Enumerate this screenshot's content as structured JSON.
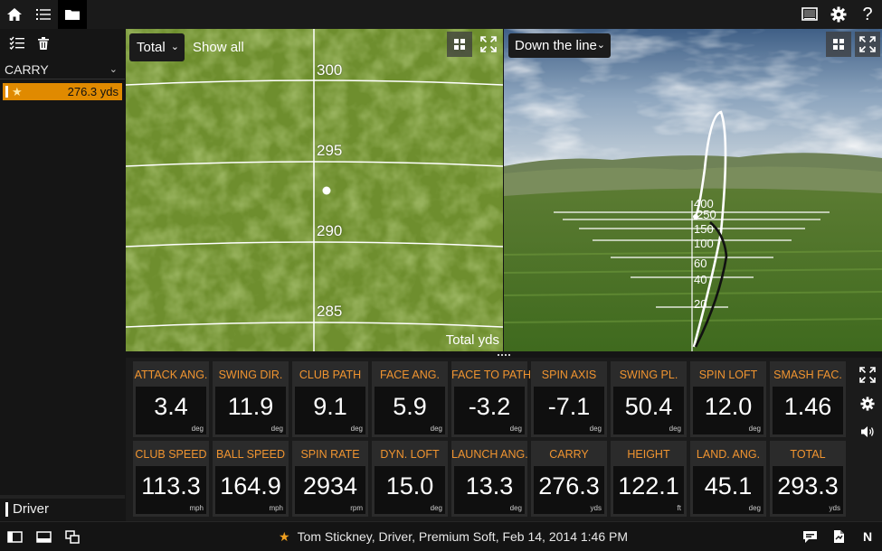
{
  "topbar": {
    "left_icons": [
      "home-icon",
      "list-icon",
      "folder-icon"
    ],
    "right_icons": [
      "screen-icon",
      "gear-icon",
      "help-icon"
    ],
    "help_glyph": "?"
  },
  "sidebar": {
    "tools": [
      "checklist-icon",
      "trash-icon"
    ],
    "parameter_selected": "CARRY",
    "shots": [
      {
        "star": "★",
        "value": "276.3 yds",
        "highlight_color": "#e08a00"
      }
    ],
    "club": "Driver"
  },
  "top_view": {
    "measure_selected": "Total",
    "show_all_label": "Show all",
    "units_label": "Total yds",
    "yard_lines": [
      "300",
      "295",
      "290",
      "285"
    ]
  },
  "down_the_line": {
    "view_selected": "Down the line",
    "distance_labels": [
      "400",
      "250",
      "150",
      "100",
      "60",
      "40",
      "20"
    ]
  },
  "metrics": {
    "row1": [
      {
        "label": "ATTACK ANG.",
        "value": "3.4",
        "unit": "deg"
      },
      {
        "label": "SWING DIR.",
        "value": "11.9",
        "unit": "deg"
      },
      {
        "label": "CLUB PATH",
        "value": "9.1",
        "unit": "deg"
      },
      {
        "label": "FACE ANG.",
        "value": "5.9",
        "unit": "deg"
      },
      {
        "label": "FACE TO PATH",
        "value": "-3.2",
        "unit": "deg"
      },
      {
        "label": "SPIN AXIS",
        "value": "-7.1",
        "unit": "deg"
      },
      {
        "label": "SWING PL.",
        "value": "50.4",
        "unit": "deg"
      },
      {
        "label": "SPIN LOFT",
        "value": "12.0",
        "unit": "deg"
      },
      {
        "label": "SMASH FAC.",
        "value": "1.46",
        "unit": ""
      }
    ],
    "row2": [
      {
        "label": "CLUB SPEED",
        "value": "113.3",
        "unit": "mph"
      },
      {
        "label": "BALL SPEED",
        "value": "164.9",
        "unit": "mph"
      },
      {
        "label": "SPIN RATE",
        "value": "2934",
        "unit": "rpm"
      },
      {
        "label": "DYN. LOFT",
        "value": "15.0",
        "unit": "deg"
      },
      {
        "label": "LAUNCH ANG.",
        "value": "13.3",
        "unit": "deg"
      },
      {
        "label": "CARRY",
        "value": "276.3",
        "unit": "yds"
      },
      {
        "label": "HEIGHT",
        "value": "122.1",
        "unit": "ft"
      },
      {
        "label": "LAND. ANG.",
        "value": "45.1",
        "unit": "deg"
      },
      {
        "label": "TOTAL",
        "value": "293.3",
        "unit": "yds"
      }
    ],
    "side_tools": [
      "fullscreen-icon",
      "gear-icon",
      "speaker-icon"
    ],
    "label_color": "#f09430"
  },
  "statusbar": {
    "star": "★",
    "text": "Tom Stickney, Driver, Premium Soft, Feb 14, 2014 1:46 PM",
    "right_letter": "N"
  }
}
